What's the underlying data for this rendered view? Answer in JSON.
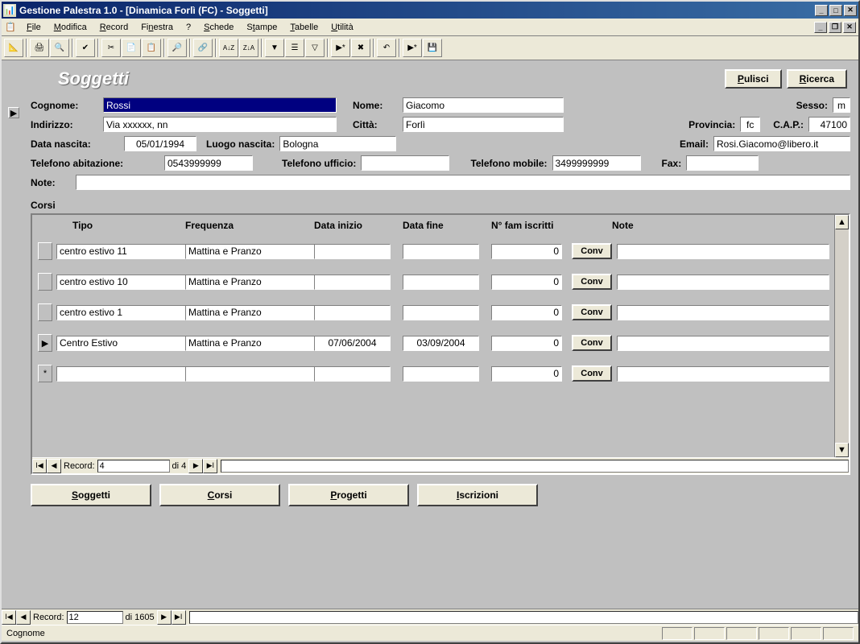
{
  "window": {
    "title": "Gestione Palestra 1.0 - [Dinamica Forlì (FC) - Soggetti]"
  },
  "menu": {
    "file": "File",
    "modifica": "Modifica",
    "record": "Record",
    "finestra": "Finestra",
    "help": "?",
    "schede": "Schede",
    "stampe": "Stampe",
    "tabelle": "Tabelle",
    "utilita": "Utilità"
  },
  "header": {
    "title": "Soggetti",
    "pulisci": "Pulisci",
    "ricerca": "Ricerca"
  },
  "labels": {
    "cognome": "Cognome:",
    "nome": "Nome:",
    "sesso": "Sesso:",
    "indirizzo": "Indirizzo:",
    "citta": "Città:",
    "provincia": "Provincia:",
    "cap": "C.A.P.:",
    "data_nascita": "Data nascita:",
    "luogo_nascita": "Luogo nascita:",
    "email": "Email:",
    "tel_abitazione": "Telefono abitazione:",
    "tel_ufficio": "Telefono ufficio:",
    "tel_mobile": "Telefono mobile:",
    "fax": "Fax:",
    "note": "Note:",
    "corsi": "Corsi"
  },
  "values": {
    "cognome": "Rossi",
    "nome": "Giacomo",
    "sesso": "m",
    "indirizzo": "Via xxxxxx, nn",
    "citta": "Forlì",
    "provincia": "fc",
    "cap": "47100",
    "data_nascita": "05/01/1994",
    "luogo_nascita": "Bologna",
    "email": "Rosi.Giacomo@libero.it",
    "tel_abitazione": "0543999999",
    "tel_ufficio": "",
    "tel_mobile": "3499999999",
    "fax": "",
    "note": ""
  },
  "corsi": {
    "cols": {
      "tipo": "Tipo",
      "frequenza": "Frequenza",
      "data_inizio": "Data inizio",
      "data_fine": "Data fine",
      "num_fam": "N° fam iscritti",
      "note": "Note"
    },
    "rows": [
      {
        "tipo": "centro estivo 11",
        "frequenza": "Mattina e Pranzo",
        "data_inizio": "",
        "data_fine": "",
        "num_fam": "0",
        "conv": "Conv",
        "note": "",
        "marker": ""
      },
      {
        "tipo": "centro estivo 10",
        "frequenza": "Mattina e Pranzo",
        "data_inizio": "",
        "data_fine": "",
        "num_fam": "0",
        "conv": "Conv",
        "note": "",
        "marker": ""
      },
      {
        "tipo": "centro estivo 1",
        "frequenza": "Mattina e Pranzo",
        "data_inizio": "",
        "data_fine": "",
        "num_fam": "0",
        "conv": "Conv",
        "note": "",
        "marker": ""
      },
      {
        "tipo": "Centro Estivo",
        "frequenza": "Mattina e Pranzo",
        "data_inizio": "07/06/2004",
        "data_fine": "03/09/2004",
        "num_fam": "0",
        "conv": "Conv",
        "note": "",
        "marker": "▶"
      },
      {
        "tipo": "",
        "frequenza": "",
        "data_inizio": "",
        "data_fine": "",
        "num_fam": "0",
        "conv": "Conv",
        "note": "",
        "marker": "*"
      }
    ],
    "nav": {
      "record_label": "Record:",
      "current": "4",
      "total": "di 4"
    }
  },
  "tabs": {
    "soggetti": "Soggetti",
    "corsi": "Corsi",
    "progetti": "Progetti",
    "iscrizioni": "Iscrizioni"
  },
  "outer_nav": {
    "record_label": "Record:",
    "current": "12",
    "total": "di 1605"
  },
  "status": {
    "text": "Cognome"
  }
}
